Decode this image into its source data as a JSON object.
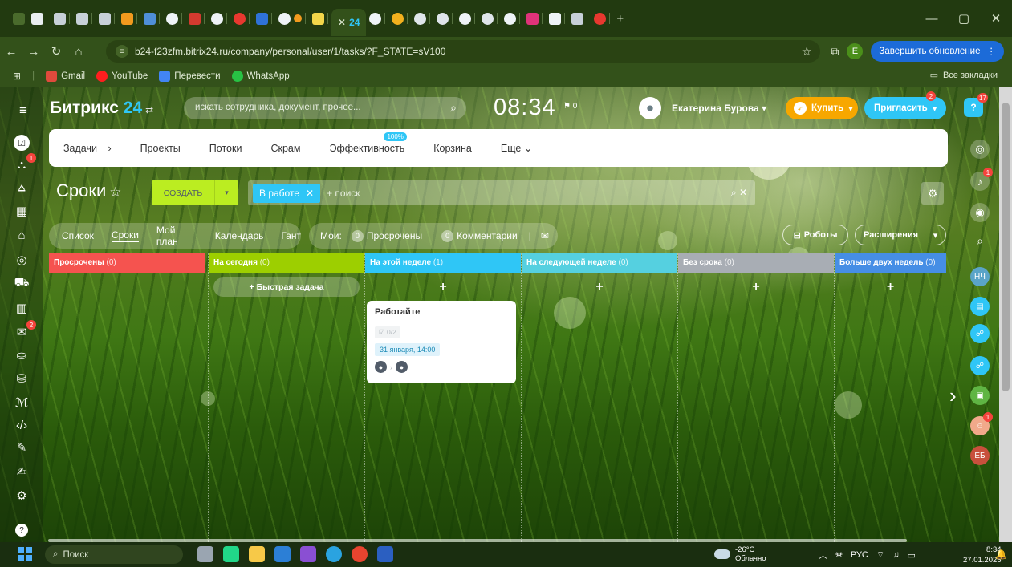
{
  "browser": {
    "tabs_active_label": "24",
    "url": "b24-f23zfm.bitrix24.ru/company/personal/user/1/tasks/?F_STATE=sV100",
    "update_button": "Завершить обновление",
    "profile_initial": "E",
    "bookmarks": [
      "Gmail",
      "YouTube",
      "Перевести",
      "WhatsApp"
    ],
    "all_bookmarks": "Все закладки",
    "colors": {
      "accent": "#1c6bd8",
      "frame": "#33511a"
    }
  },
  "header": {
    "logo_text": "Битрикс",
    "logo_num": "24",
    "search_placeholder": "искать сотрудника, документ, прочее...",
    "clock": "08:34",
    "flag_count": "0",
    "user_name": "Екатерина Бурова",
    "buy_label": "Купить",
    "invite_label": "Пригласить",
    "invite_badge": "2",
    "help_badge": "17"
  },
  "topnav": {
    "items": [
      "Задачи",
      "Проекты",
      "Потоки",
      "Скрам",
      "Эффективность",
      "Корзина",
      "Еще"
    ],
    "efficiency_pct": "100%"
  },
  "toolbar": {
    "title": "Сроки",
    "create_label": "СОЗДАТЬ",
    "filter_chip": "В работе",
    "filter_search": "+ поиск"
  },
  "views": {
    "items": [
      "Список",
      "Сроки",
      "Мой план",
      "Календарь",
      "Гант"
    ],
    "active": "Сроки",
    "my_label": "Мои:",
    "overdue_label": "Просрочены",
    "overdue_count": "0",
    "comments_label": "Комментарии",
    "comments_count": "0",
    "robots_label": "Роботы",
    "extensions_label": "Расширения"
  },
  "kanban": {
    "quick_task": "+ Быстрая задача",
    "columns": [
      {
        "title": "Просрочены",
        "count": "(0)",
        "color": "#f5534f"
      },
      {
        "title": "На сегодня",
        "count": "(0)",
        "color": "#9dcf00"
      },
      {
        "title": "На этой неделе",
        "count": "(1)",
        "color": "#2fc6f6"
      },
      {
        "title": "На следующей неделе",
        "count": "(0)",
        "color": "#55d0e0"
      },
      {
        "title": "Без срока",
        "count": "(0)",
        "color": "#a8adb4"
      },
      {
        "title": "Больше двух недель",
        "count": "(0)",
        "color": "#468ee5"
      }
    ],
    "card": {
      "title": "Работайте",
      "checklist": "0/2",
      "deadline": "31 января, 14:00"
    }
  },
  "leftbar": {
    "badges": [
      "1",
      "2"
    ]
  },
  "rightbar": {
    "avatars": [
      "НЧ",
      "ЕБ"
    ],
    "bell_badge": "1",
    "user_badge": "1"
  },
  "taskbar": {
    "search_label": "Поиск",
    "weather_temp": "-26°C",
    "weather_desc": "Облачно",
    "lang": "РУС",
    "time": "8:34",
    "date": "27.01.2025"
  }
}
